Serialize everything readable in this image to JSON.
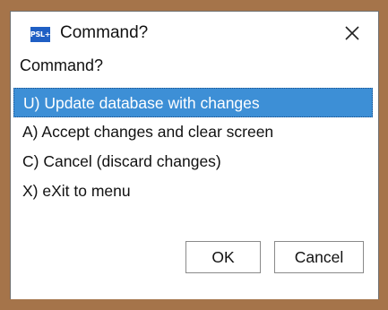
{
  "window": {
    "title": "Command?",
    "app_icon_text": "PSL+",
    "close_icon": "close-icon"
  },
  "prompt": "Command?",
  "options": [
    {
      "label": "U) Update database with changes",
      "selected": true
    },
    {
      "label": "A) Accept changes and clear screen",
      "selected": false
    },
    {
      "label": "C) Cancel (discard changes)",
      "selected": false
    },
    {
      "label": "X) eXit to menu",
      "selected": false
    }
  ],
  "buttons": {
    "ok_label": "OK",
    "cancel_label": "Cancel"
  },
  "colors": {
    "selection": "#3d8fd6",
    "app_icon": "#1f5fc4",
    "backdrop": "#a5744a"
  }
}
